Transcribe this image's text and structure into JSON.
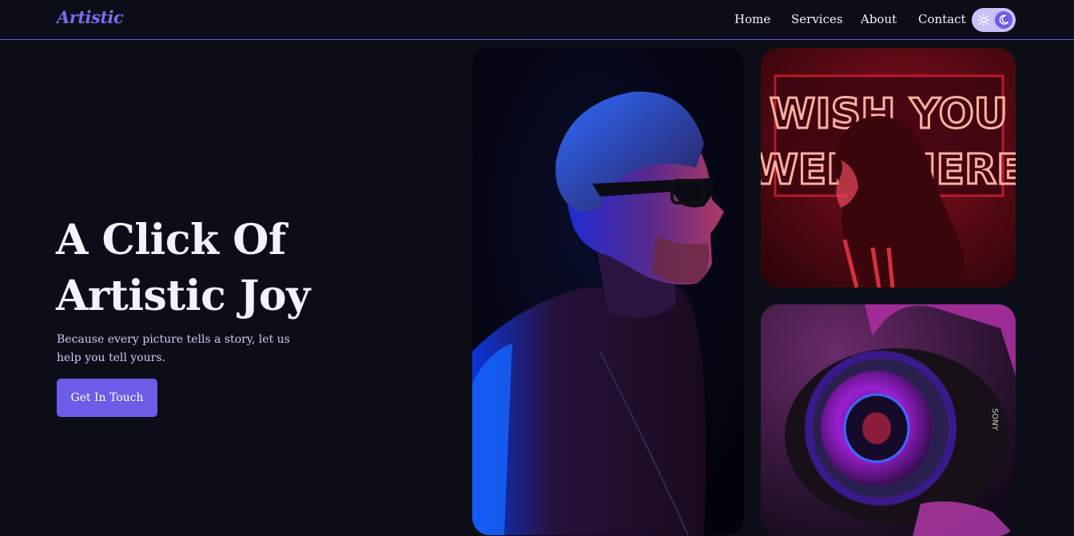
{
  "nav": {
    "logo": "Artistic",
    "links": [
      "Home",
      "Services",
      "About",
      "Contact"
    ],
    "theme_toggle": {
      "light_icon": "sun-icon",
      "dark_icon": "moon-icon",
      "active": "dark"
    }
  },
  "hero": {
    "title_line1": "A Click Of",
    "title_line2": "Artistic Joy",
    "subtitle": "Because every picture tells a story, let us help you tell yours.",
    "cta_label": "Get In Touch"
  },
  "gallery": {
    "neon_sign_text": "WISH YOU WERE HERE",
    "lens_brand": "SONY"
  },
  "colors": {
    "background": "#0b0d17",
    "accent": "#6c5ce7",
    "nav_border": "#6a5ee0",
    "toggle_bg": "#c9c2f7"
  }
}
